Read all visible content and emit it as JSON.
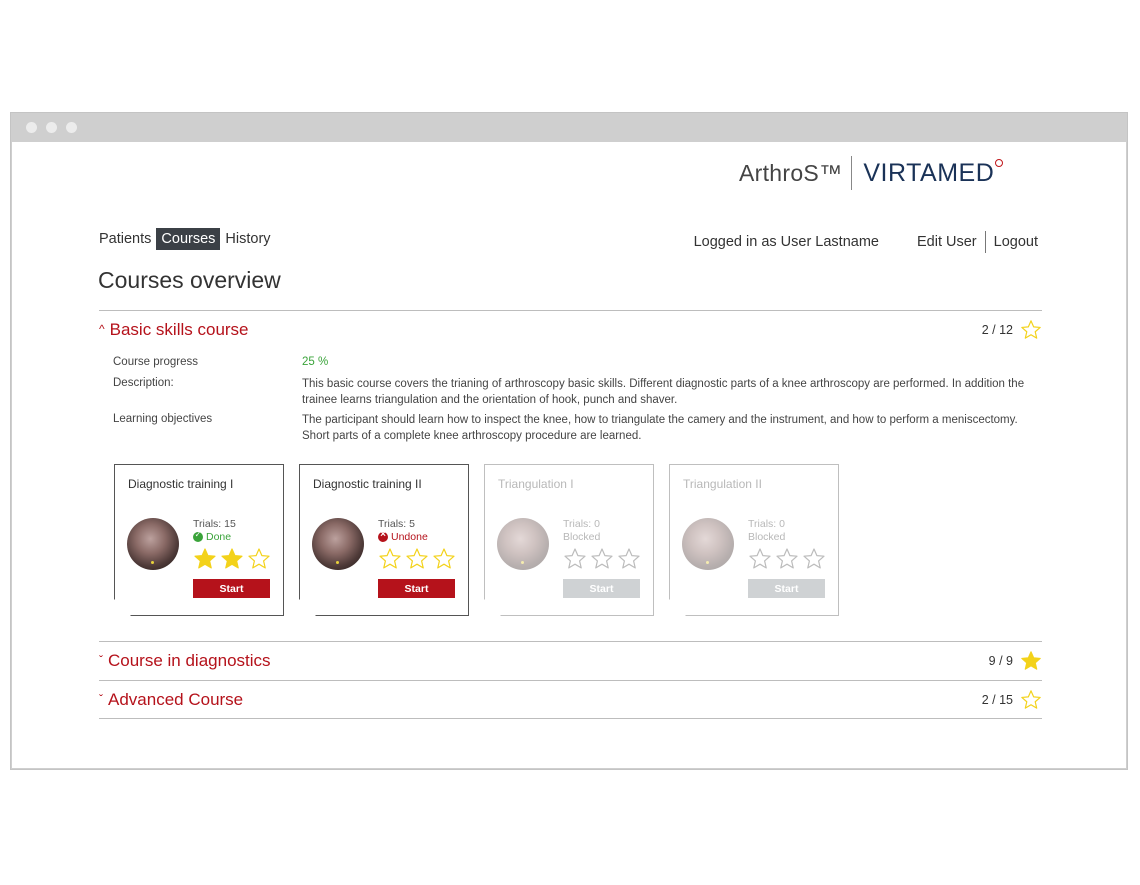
{
  "brand": {
    "product": "ArthroS™",
    "company": "VIRTAMED"
  },
  "nav": {
    "items": [
      {
        "label": "Patients",
        "active": false
      },
      {
        "label": "Courses",
        "active": true
      },
      {
        "label": "History",
        "active": false
      }
    ]
  },
  "user": {
    "login_text": "Logged in as User Lastname",
    "edit_label": "Edit User",
    "logout_label": "Logout"
  },
  "page": {
    "title": "Courses overview"
  },
  "courses": [
    {
      "title": "Basic skills course",
      "expanded": true,
      "count": "2 / 12",
      "star": "empty",
      "progress_label": "Course progress",
      "progress_value": "25 %",
      "description_label": "Description:",
      "description": "This basic course covers the trianing of arthroscopy basic skills. Different diagnostic parts of a knee arthroscopy are performed. In addition the trainee learns triangulation and the orientation of hook, punch and shaver.",
      "objectives_label": "Learning objectives",
      "objectives": "The participant should learn how to inspect the knee, how to triangulate the camery and the instrument, and how to perform a meniscectomy. Short parts of a complete knee arthroscopy procedure are learned.",
      "modules": [
        {
          "title": "Diagnostic training I",
          "trials": "Trials: 15",
          "status": "Done",
          "status_type": "done",
          "stars": 2,
          "button": "Start",
          "blocked": false
        },
        {
          "title": "Diagnostic training II",
          "trials": "Trials: 5",
          "status": "Undone",
          "status_type": "undone",
          "stars": 0,
          "button": "Start",
          "blocked": false
        },
        {
          "title": "Triangulation I",
          "trials": "Trials: 0",
          "status": "Blocked",
          "status_type": "blocked",
          "stars": 0,
          "button": "Start",
          "blocked": true
        },
        {
          "title": "Triangulation II",
          "trials": "Trials: 0",
          "status": "Blocked",
          "status_type": "blocked",
          "stars": 0,
          "button": "Start",
          "blocked": true
        }
      ]
    },
    {
      "title": "Course in diagnostics",
      "expanded": false,
      "count": "9 / 9",
      "star": "filled"
    },
    {
      "title": "Advanced Course",
      "expanded": false,
      "count": "2 / 15",
      "star": "empty"
    }
  ],
  "colors": {
    "accent": "#b5121b",
    "nav_active": "#3b4046",
    "star_fill": "#f3d21a",
    "star_outline": "#f3d21a",
    "progress": "#3aa33a",
    "blocked": "#cfd2d4"
  }
}
